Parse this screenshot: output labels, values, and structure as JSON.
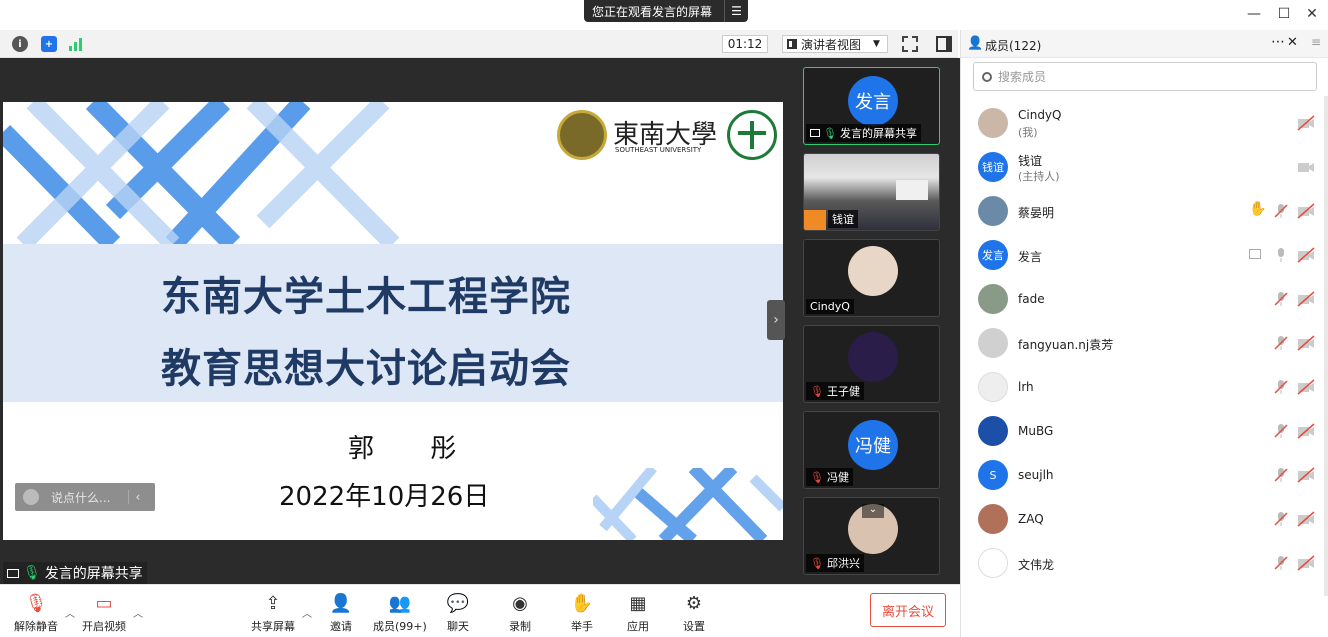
{
  "banner": {
    "text": "您正在观看发言的屏幕",
    "menu_icon": "list-icon"
  },
  "toolbar": {
    "timer": "01:12",
    "view": "演讲者视图"
  },
  "slide": {
    "title_line1": "东南大学土木工程学院",
    "title_line2": "教育思想大讨论启动会",
    "author": "郭 彤",
    "date": "2022年10月26日",
    "logo_text_cn": "東南大學",
    "logo_text_en": "SOUTHEAST UNIVERSITY"
  },
  "chat_placeholder": "说点什么...",
  "share_label": "发言的屏幕共享",
  "thumbnails": [
    {
      "name": "发言的屏幕共享",
      "avatar": "发言",
      "active": true
    },
    {
      "name": "钱谊",
      "avatar": "",
      "active": false
    },
    {
      "name": "CindyQ",
      "avatar": "",
      "active": false
    },
    {
      "name": "王子健",
      "avatar": "",
      "active": false
    },
    {
      "name": "冯健",
      "avatar": "冯健",
      "active": false
    },
    {
      "name": "邱洪兴",
      "avatar": "",
      "active": false
    }
  ],
  "bottom": {
    "unmute": "解除静音",
    "start_video": "开启视频",
    "share": "共享屏幕",
    "invite": "邀请",
    "members": "成员(99+)",
    "chat": "聊天",
    "record": "录制",
    "raise_hand": "举手",
    "apps": "应用",
    "settings": "设置",
    "leave": "离开会议"
  },
  "panel": {
    "title": "成员(122)",
    "search_placeholder": "搜索成员",
    "members": [
      {
        "name": "CindyQ",
        "sub": "(我)",
        "avatar": "",
        "color": "#cbb7a8"
      },
      {
        "name": "钱谊",
        "sub": "(主持人)",
        "avatar": "钱谊",
        "color": "#1e74e8"
      },
      {
        "name": "蔡晏明",
        "sub": "",
        "avatar": "",
        "color": "#6a8aa8"
      },
      {
        "name": "发言",
        "sub": "",
        "avatar": "发言",
        "color": "#1e74e8"
      },
      {
        "name": "fade",
        "sub": "",
        "avatar": "",
        "color": "#8a9a88"
      },
      {
        "name": "fangyuan.nj袁芳",
        "sub": "",
        "avatar": "",
        "color": "#d0d0d0"
      },
      {
        "name": "lrh",
        "sub": "",
        "avatar": "",
        "color": "#eeeeee"
      },
      {
        "name": "MuBG",
        "sub": "",
        "avatar": "",
        "color": "#1b4fa8"
      },
      {
        "name": "seujlh",
        "sub": "",
        "avatar": "S",
        "color": "#1e74e8"
      },
      {
        "name": "ZAQ",
        "sub": "",
        "avatar": "",
        "color": "#b0705a"
      },
      {
        "name": "文伟龙",
        "sub": "",
        "avatar": "",
        "color": "#ffffff"
      }
    ]
  }
}
